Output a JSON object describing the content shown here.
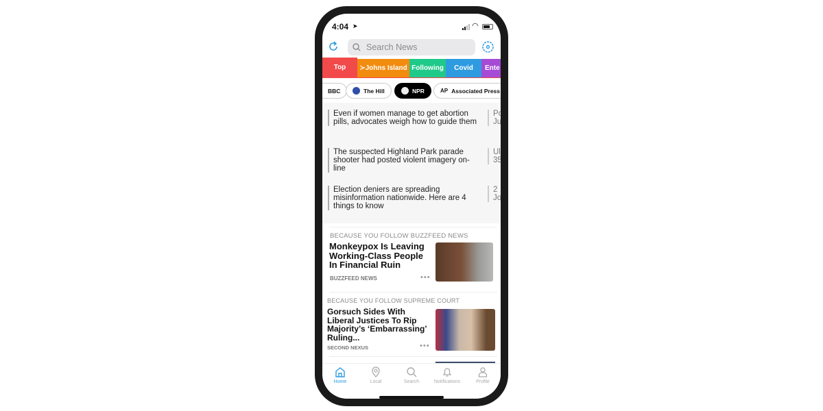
{
  "status": {
    "time": "4:04"
  },
  "search": {
    "placeholder": "Search News"
  },
  "categories": [
    {
      "label": "Top",
      "color": "#f24a4a"
    },
    {
      "label": "≻Johns Island",
      "color": "#f28c0f"
    },
    {
      "label": "Following",
      "color": "#1fc98a"
    },
    {
      "label": "Covid",
      "color": "#2e9be0"
    },
    {
      "label": "Ente",
      "color": "#a64bd6"
    }
  ],
  "sources": [
    {
      "label": "BBC"
    },
    {
      "label": "The Hill"
    },
    {
      "label": "NPR",
      "selected": true
    },
    {
      "label": "Associated Press"
    }
  ],
  "headlines": [
    {
      "title": "Even if women manage to get abortion pills, advocates weigh how to guide them",
      "side": "Po\nJu"
    },
    {
      "title": "The suspected Highland Park parade shooter had posted violent imagery on-line",
      "side": "Ul\n35"
    },
    {
      "title": "Election deniers are spreading misinformation nationwide. Here are 4 things to know",
      "side": "2\nJo"
    }
  ],
  "cards": [
    {
      "kicker": "BECAUSE YOU FOLLOW BUZZFEED NEWS",
      "title": "Monkeypox Is Leaving Working-Class People In Financial Ruin",
      "source": "BUZZFEED NEWS",
      "more": "•••"
    },
    {
      "kicker": "BECAUSE YOU FOLLOW SUPREME COURT",
      "title": "Gorsuch Sides With Liberal Justices To Rip Majority’s ‘Embarrassing’ Ruling...",
      "source": "SECOND NEXUS",
      "more": "•••"
    }
  ],
  "tabbar": [
    {
      "label": "Home",
      "active": true
    },
    {
      "label": "Local"
    },
    {
      "label": "Search"
    },
    {
      "label": "Notifications"
    },
    {
      "label": "Profile"
    }
  ],
  "accent": "#2e9be0"
}
